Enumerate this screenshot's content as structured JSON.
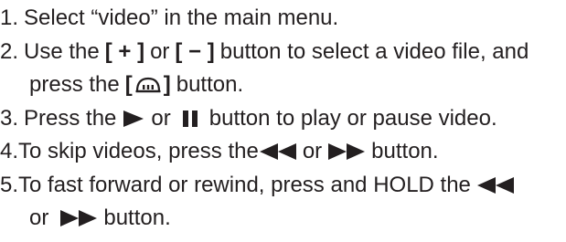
{
  "steps": [
    {
      "number": "1.",
      "text": "Select “video” in the main menu."
    },
    {
      "number": "2.",
      "text_a": "Use the",
      "plus_button": "[ + ]",
      "or": "or",
      "minus_button": "[ − ]",
      "text_b": "button to select a video file, and",
      "text_c": "press the",
      "bracket_open": "[",
      "bracket_close": "]",
      "text_d": "button."
    },
    {
      "number": "3.",
      "text_a": "Press the",
      "or": "or",
      "text_b": "button to play or pause video."
    },
    {
      "number": "4.",
      "text_a": "To skip videos, press the",
      "or": "or",
      "text_b": "button."
    },
    {
      "number": "5.",
      "text_a": "To fast forward or rewind, press and HOLD the",
      "text_b": "or",
      "text_c": "button."
    }
  ],
  "colors": {
    "text": "#231f20",
    "icon": "#231f20"
  },
  "icons": {
    "play": "play-icon",
    "pause": "pause-icon",
    "rewind": "rewind-icon",
    "fast_forward": "fast-forward-icon",
    "menu_button": "menu-button-icon"
  }
}
